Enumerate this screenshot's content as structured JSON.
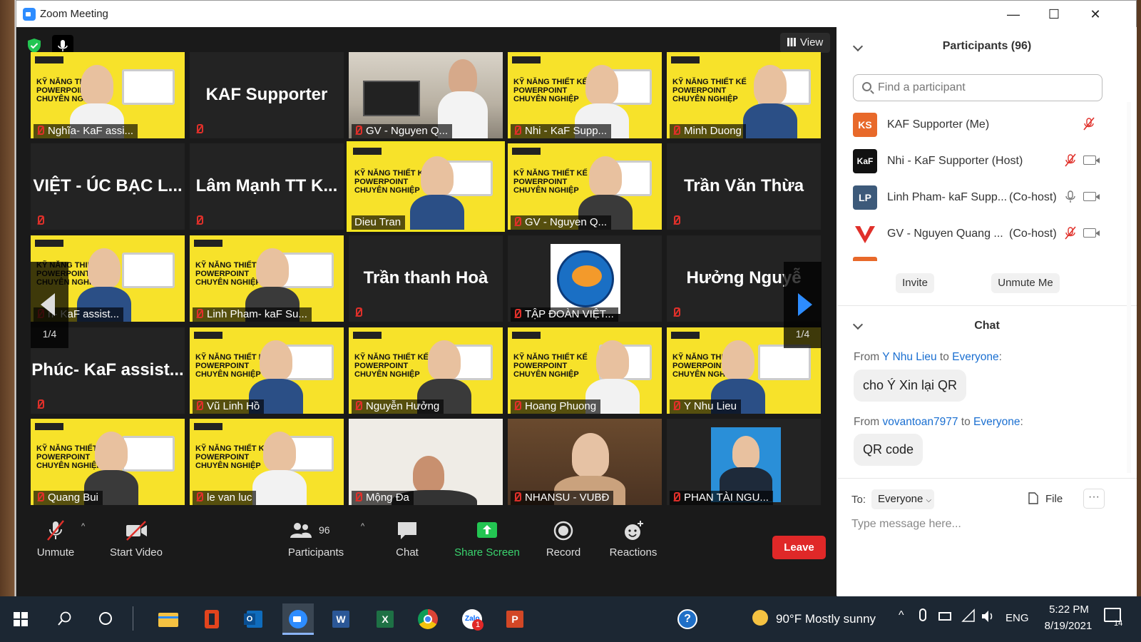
{
  "window": {
    "title": "Zoom Meeting",
    "controls": [
      "—",
      "☐",
      "✕"
    ]
  },
  "stage": {
    "view_label": "View"
  },
  "tiles": [
    {
      "label": "Nghĩa- KaF assi...",
      "bg": "slide"
    },
    {
      "big": "KAF Supporter",
      "bg": "dark"
    },
    {
      "label": "GV - Nguyen Q...",
      "bg": "room"
    },
    {
      "label": "Nhi - KaF Supp...",
      "bg": "slide"
    },
    {
      "label": "Minh Duong",
      "bg": "slide"
    },
    {
      "big": "VIỆT - ÚC BẠC L...",
      "bg": "dark"
    },
    {
      "big": "Lâm Mạnh TT K...",
      "bg": "dark"
    },
    {
      "label": "Dieu Tran",
      "bg": "slide",
      "active": true
    },
    {
      "label": "GV - Nguyen Q...",
      "bg": "slide"
    },
    {
      "big": "Trần Văn Thừa",
      "bg": "dark"
    },
    {
      "label": "n- KaF assist...",
      "bg": "slide"
    },
    {
      "label": "Linh Pham- kaF Su...",
      "bg": "slide"
    },
    {
      "big": "Trần thanh Hoà",
      "bg": "dark"
    },
    {
      "label": "TẬP ĐOÀN VIỆT...",
      "bg": "logo"
    },
    {
      "big": "Hưởng Nguyễ",
      "bg": "dark"
    },
    {
      "big": "Phúc- KaF assist...",
      "bg": "dark"
    },
    {
      "label": "Vũ Linh Hồ",
      "bg": "slide"
    },
    {
      "label": "Nguyễn Hưởng",
      "bg": "slide"
    },
    {
      "label": "Hoang Phuong",
      "bg": "slide"
    },
    {
      "label": "Y Nhu Lieu",
      "bg": "slide"
    },
    {
      "label": "Quang Bui",
      "bg": "slide"
    },
    {
      "label": "le van luc",
      "bg": "slide"
    },
    {
      "label": "Mộng Đa",
      "bg": "white"
    },
    {
      "label": "NHANSU - VUBĐ",
      "bg": "brown"
    },
    {
      "label": "PHAN TÀI NGU...",
      "bg": "portrait"
    }
  ],
  "pager": {
    "left": "1/4",
    "right": "1/4"
  },
  "toolbar": {
    "unmute": "Unmute",
    "start_video": "Start Video",
    "participants": "Participants",
    "participants_count": "96",
    "chat": "Chat",
    "share_screen": "Share Screen",
    "record": "Record",
    "reactions": "Reactions",
    "leave": "Leave"
  },
  "panel": {
    "participants_title": "Participants (96)",
    "find_placeholder": "Find a participant",
    "participants": [
      {
        "initials": "KS",
        "name": "KAF Supporter (Me)",
        "role": "",
        "color": "#e8692a"
      },
      {
        "initials": "KaF",
        "name": "Nhi - KaF Supporter (Host)",
        "role": "",
        "color": "#111111"
      },
      {
        "initials": "LP",
        "name": "Linh Pham- kaF Supp...",
        "role": "(Co-host)",
        "color": "#3d5a7a"
      },
      {
        "initials": "V",
        "name": "GV - Nguyen Quang ...",
        "role": "(Co-host)",
        "color": "#ffffff"
      }
    ],
    "invite": "Invite",
    "unmute_me": "Unmute Me",
    "chat_title": "Chat",
    "messages": [
      {
        "from_prefix": "From ",
        "sender": "Y Nhu Lieu",
        "to_word": " to ",
        "recipient": "Everyone",
        "colon": ":",
        "text": "cho Ý Xin lại QR"
      },
      {
        "from_prefix": "From ",
        "sender": "vovantoan7977",
        "to_word": " to ",
        "recipient": "Everyone",
        "colon": ":",
        "text": "QR code"
      }
    ],
    "to_label": "To:",
    "to_value": "Everyone",
    "file_label": "File",
    "more_label": "···",
    "type_placeholder": "Type message here..."
  },
  "taskbar": {
    "weather": "90°F  Mostly sunny",
    "lang": "ENG",
    "time": "5:22 PM",
    "date": "8/19/2021",
    "notif_count": "14",
    "zalo_badge": "1"
  }
}
